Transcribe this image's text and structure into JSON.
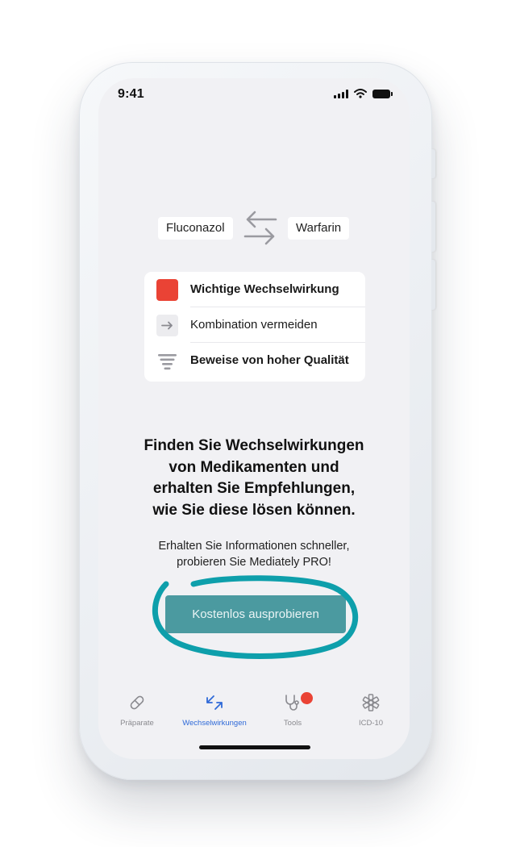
{
  "status_bar": {
    "time": "9:41"
  },
  "interaction": {
    "drug_left": "Fluconazol",
    "drug_right": "Warfarin",
    "swap_icon": "arrows-swap-icon",
    "details": [
      {
        "icon": "red-square-icon",
        "label": "Wichtige Wechselwirkung",
        "color": "#ea4335"
      },
      {
        "icon": "arrow-right-icon",
        "label": "Kombination vermeiden"
      },
      {
        "icon": "evidence-bars-icon",
        "label": "Beweise von hoher Qualität"
      }
    ]
  },
  "promo": {
    "headline_lines": [
      "Finden Sie Wechselwirkungen",
      "von Medikamenten und",
      "erhalten Sie Empfehlungen,",
      "wie Sie diese lösen können."
    ],
    "subline_lines": [
      "Erhalten Sie Informationen schneller,",
      "probieren Sie Mediately PRO!"
    ],
    "cta_label": "Kostenlos ausprobieren",
    "cta_color": "#4b9aa0",
    "highlight_color": "#0e9fab"
  },
  "tab_bar": {
    "active_color": "#2f6ad8",
    "items": [
      {
        "label": "Präparate",
        "icon": "pill-icon",
        "active": false
      },
      {
        "label": "Wechselwirkungen",
        "icon": "interaction-arrows-icon",
        "active": true
      },
      {
        "label": "Tools",
        "icon": "stethoscope-icon",
        "active": false,
        "badge": true
      },
      {
        "label": "ICD-10",
        "icon": "asterisk-icon",
        "active": false
      }
    ]
  }
}
